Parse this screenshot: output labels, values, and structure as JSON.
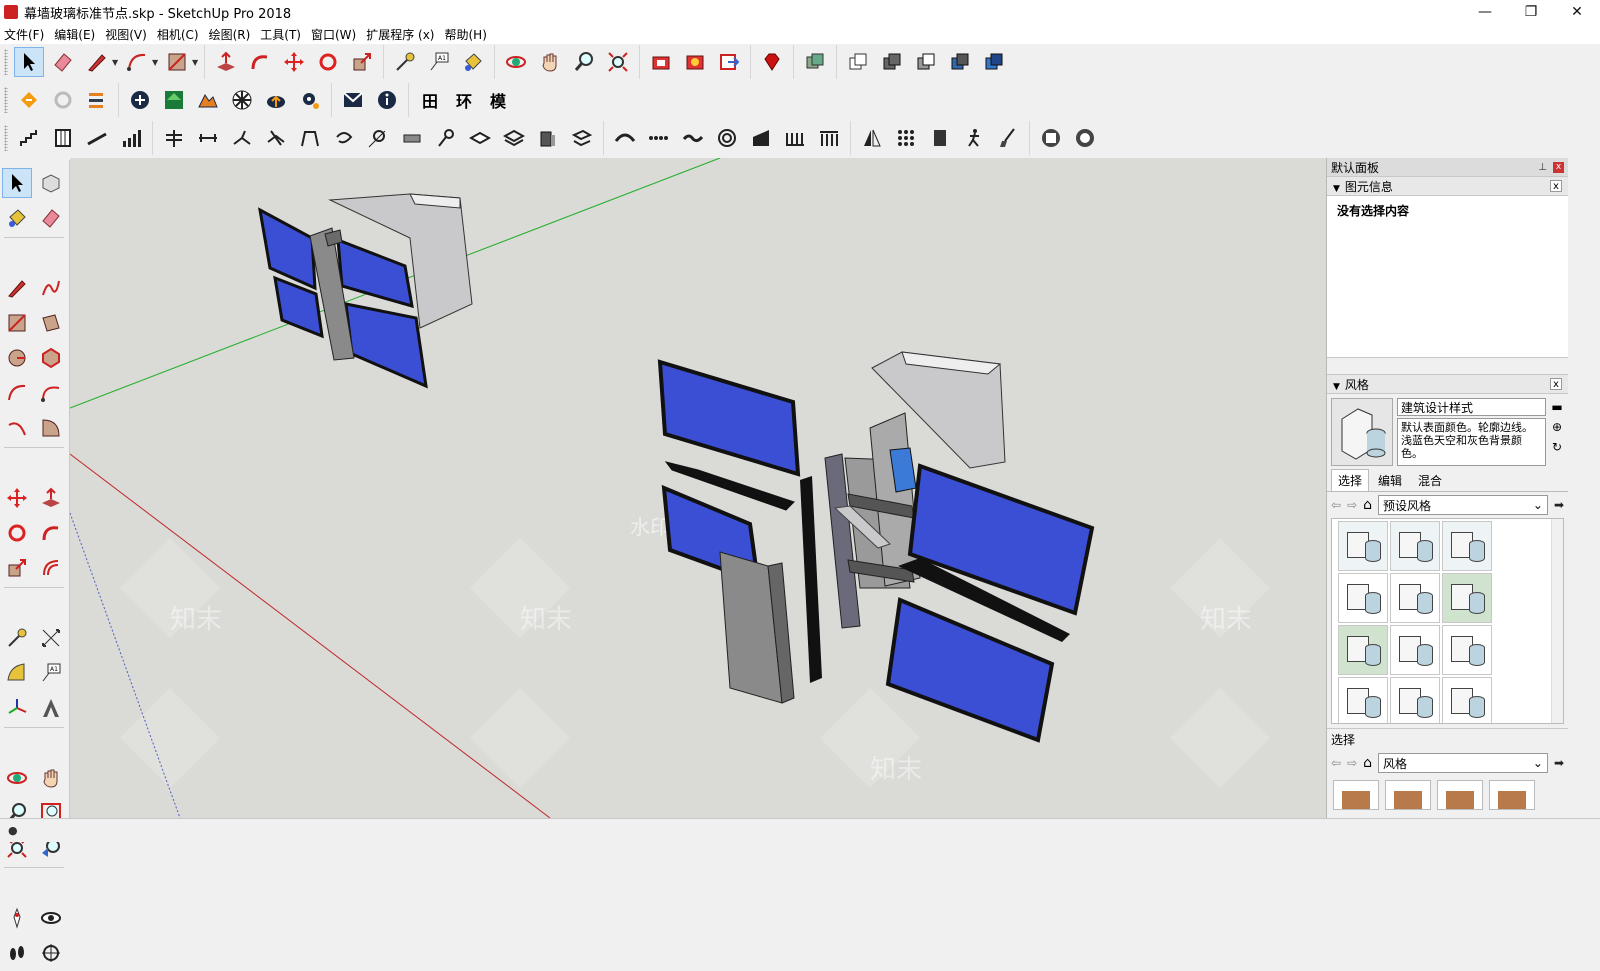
{
  "window": {
    "title": "幕墙玻璃标准节点.skp - SketchUp Pro 2018",
    "minimize": "—",
    "maximize": "❐",
    "close": "✕"
  },
  "menu": [
    "文件(F)",
    "编辑(E)",
    "视图(V)",
    "相机(C)",
    "绘图(R)",
    "工具(T)",
    "窗口(W)",
    "扩展程序 (x)",
    "帮助(H)"
  ],
  "toolbar_text_buttons": {
    "grid": "田",
    "ring": "环",
    "model": "模"
  },
  "tray": {
    "title": "默认面板",
    "entity_info": {
      "header": "图元信息",
      "body": "没有选择内容"
    },
    "styles": {
      "header": "风格",
      "name": "建筑设计样式",
      "description": "默认表面颜色。轮廓边线。浅蓝色天空和灰色背景颜色。",
      "tabs": [
        "选择",
        "编辑",
        "混合"
      ],
      "dropdown": "预设风格"
    },
    "secondary": {
      "label": "选择",
      "dropdown": "风格"
    }
  },
  "watermark": {
    "center": "水印保护区",
    "text": "知末"
  },
  "colors": {
    "axis_green": "#1fae2a",
    "axis_red": "#c02828",
    "glass_blue": "#3b4fd4",
    "frame_gray": "#8a8a8a"
  }
}
